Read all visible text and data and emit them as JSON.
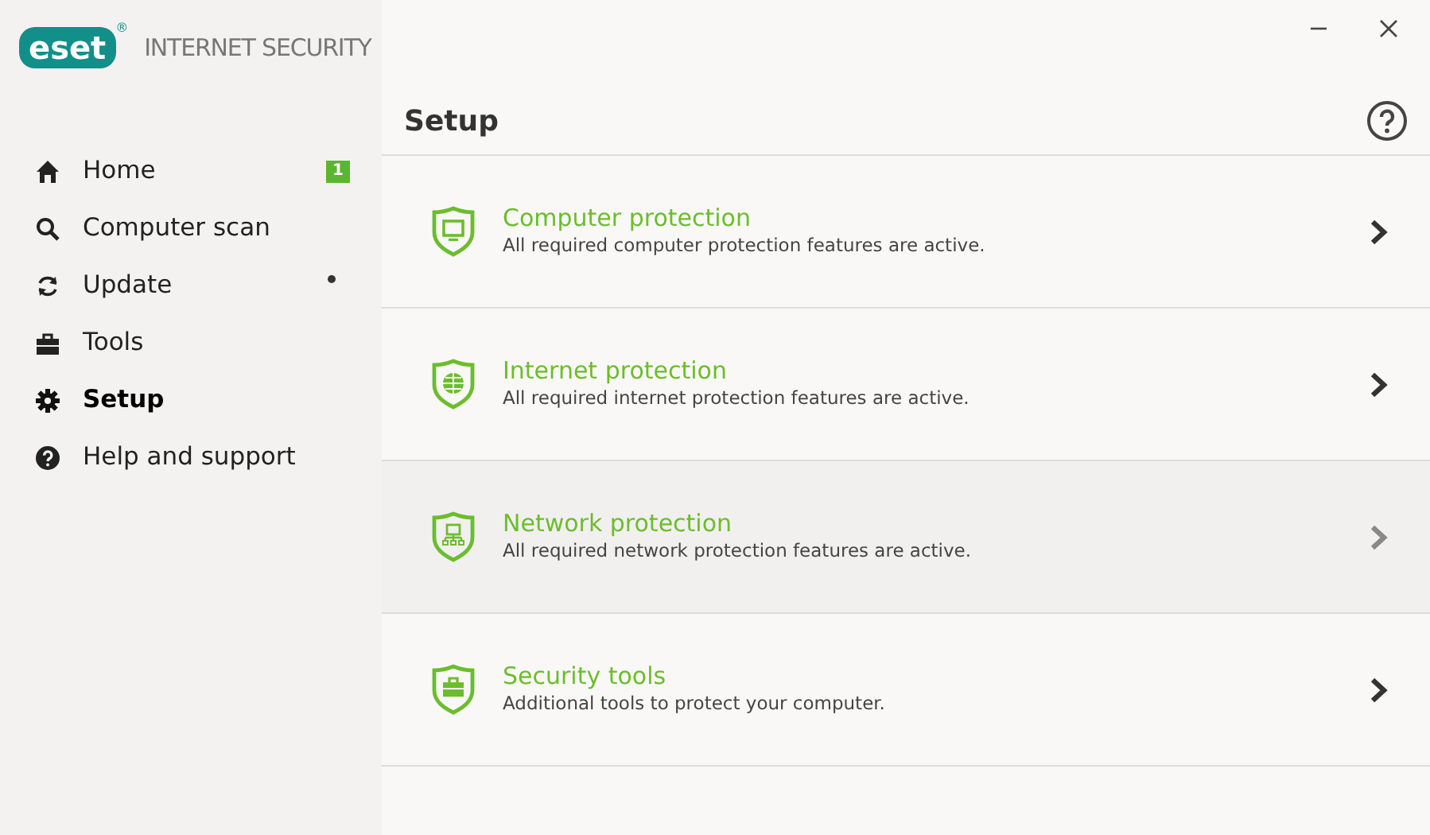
{
  "app": {
    "logo": "eset",
    "registered_mark": "®",
    "product": "INTERNET SECURITY"
  },
  "sidebar": {
    "items": [
      {
        "kind": "home",
        "label": "Home",
        "selected": false,
        "badge": "1",
        "notification_dot": false
      },
      {
        "kind": "scan",
        "label": "Computer scan",
        "selected": false,
        "notification_dot": false
      },
      {
        "kind": "update",
        "label": "Update",
        "selected": false,
        "notification_dot": true
      },
      {
        "kind": "tools",
        "label": "Tools",
        "selected": false,
        "notification_dot": false
      },
      {
        "kind": "setup",
        "label": "Setup",
        "selected": true,
        "notification_dot": false
      },
      {
        "kind": "help",
        "label": "Help and support",
        "selected": false,
        "notification_dot": false
      }
    ]
  },
  "page": {
    "title": "Setup"
  },
  "sections": [
    {
      "kind": "computer",
      "title": "Computer protection",
      "description": "All required computer protection features are active.",
      "hovered": false
    },
    {
      "kind": "internet",
      "title": "Internet protection",
      "description": "All required internet protection features are active.",
      "hovered": false
    },
    {
      "kind": "network",
      "title": "Network protection",
      "description": "All required network protection features are active.",
      "hovered": true
    },
    {
      "kind": "tools",
      "title": "Security tools",
      "description": "Additional tools to protect your computer.",
      "hovered": false
    }
  ]
}
